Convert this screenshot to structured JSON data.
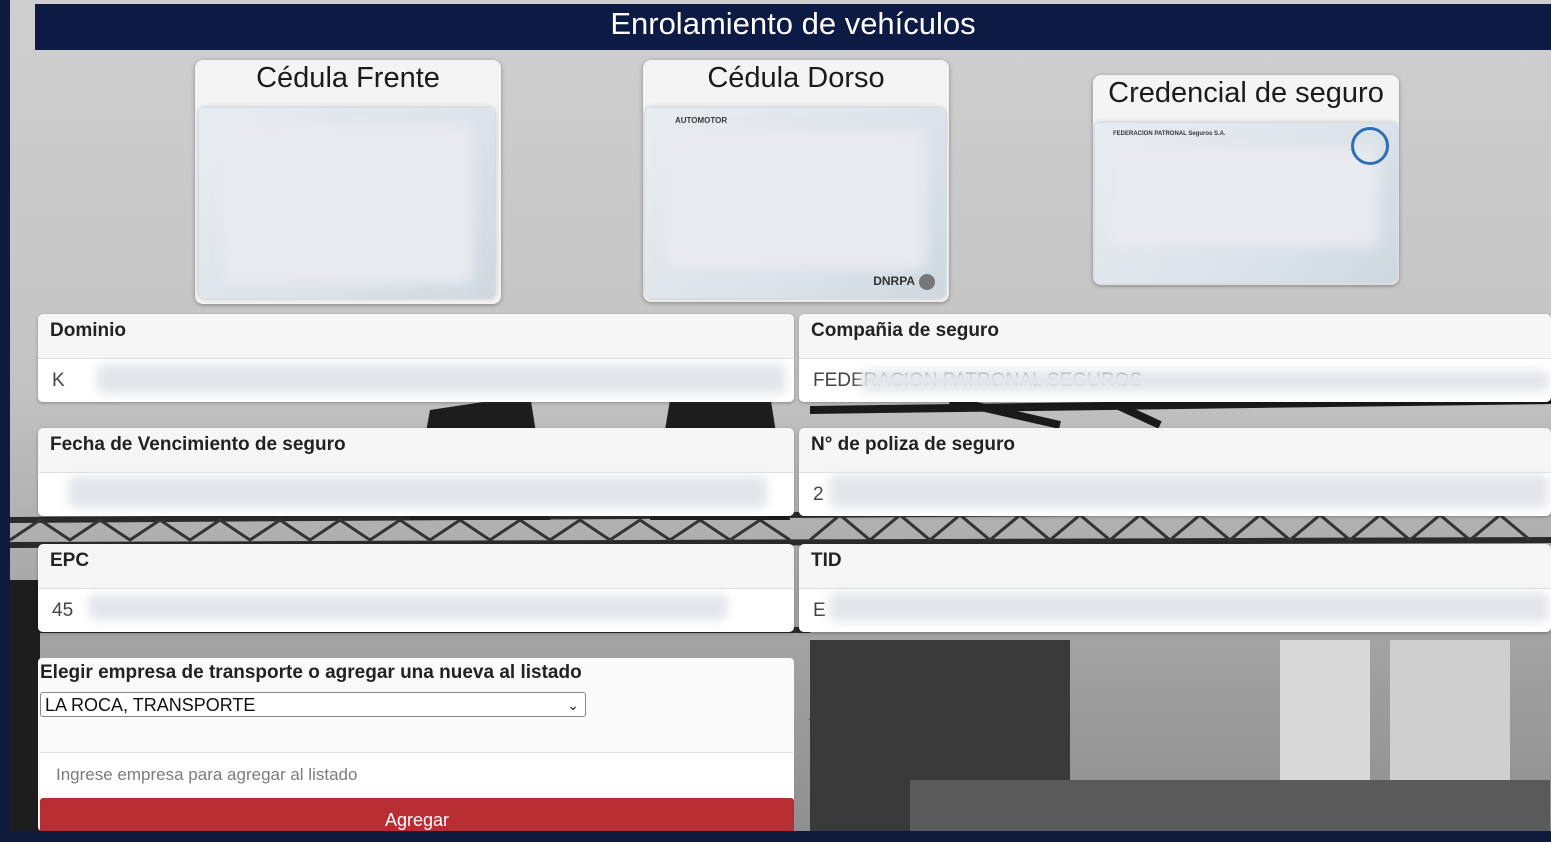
{
  "header": {
    "title": "Enrolamiento de vehículos"
  },
  "documents": [
    {
      "title": "Cédula Frente",
      "overlay_text": ""
    },
    {
      "title": "Cédula Dorso",
      "overlay_text": "AUTOMOTOR",
      "badge": "DNRPA"
    },
    {
      "title": "Credencial de seguro",
      "overlay_text": "FEDERACION PATRONAL Seguros S.A."
    }
  ],
  "fields": {
    "dominio": {
      "label": "Dominio",
      "value": "K"
    },
    "compania": {
      "label": "Compañia de seguro",
      "value": "FEDERACION PATRONAL SEGUROS"
    },
    "vencimiento": {
      "label": "Fecha de Vencimiento de seguro",
      "value": ""
    },
    "poliza": {
      "label": "N° de poliza de seguro",
      "value": "2"
    },
    "epc": {
      "label": "EPC",
      "value": "45"
    },
    "tid": {
      "label": "TID",
      "value": "E"
    }
  },
  "transport": {
    "label": "Elegir empresa de transporte o agregar una nueva al listado",
    "selected": "LA ROCA, TRANSPORTE",
    "new_placeholder": "Ingrese empresa para agregar al listado",
    "add_label": "Agregar"
  },
  "colors": {
    "header_bg": "#0c1a44",
    "button_bg": "#b82d32",
    "frame_bg": "#0f1b3d"
  }
}
